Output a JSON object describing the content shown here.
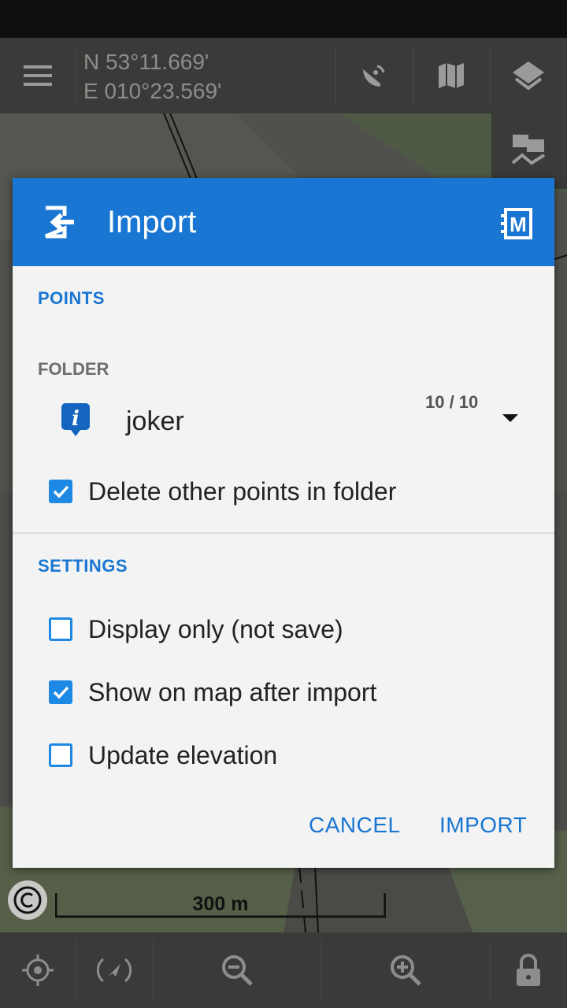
{
  "map": {
    "coord_lat": "N 53°11.669'",
    "coord_lon": "E 010°23.569'",
    "scale_label": "300 m"
  },
  "topbar": {
    "icons": [
      "menu-icon",
      "satellite-icon",
      "map-icon",
      "layers-icon"
    ]
  },
  "dialog": {
    "title": "Import",
    "points_section": "POINTS",
    "folder_label": "FOLDER",
    "folder_name": "joker",
    "folder_count": "10 / 10",
    "delete_other": {
      "label": "Delete other points in folder",
      "checked": true
    },
    "settings_section": "SETTINGS",
    "display_only": {
      "label": "Display only (not save)",
      "checked": false
    },
    "show_on_map": {
      "label": "Show on map after import",
      "checked": true
    },
    "update_elevation": {
      "label": "Update elevation",
      "checked": false
    },
    "cancel_label": "CANCEL",
    "import_label": "IMPORT"
  },
  "colors": {
    "accent": "#1976d2",
    "checkbox": "#1e88e5",
    "dialog_bg": "#f3f3f3",
    "bar_bg": "#3a3a38"
  },
  "bottombar": {
    "icons": [
      "gps-icon",
      "rotate-icon",
      "zoom-out-icon",
      "zoom-in-icon",
      "lock-icon"
    ]
  }
}
